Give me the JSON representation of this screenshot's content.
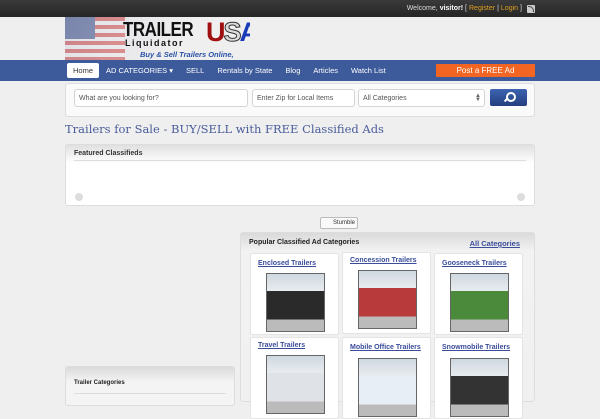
{
  "topbar": {
    "welcome": "Welcome,",
    "user": "visitor!",
    "open": "[",
    "register": "Register",
    "sep": "|",
    "login": "Login",
    "close": "]"
  },
  "logo": {
    "line1": "TRAILER",
    "line2": "Liquidator",
    "usa_u": "U",
    "usa_s": "S",
    "usa_a": "A",
    "tagline": "Buy & Sell Trailers Online, FREE!"
  },
  "nav": {
    "items": [
      "Home",
      "AD CATEGORIES ▾",
      "SELL",
      "Rentals by State",
      "Blog",
      "Articles",
      "Watch List"
    ],
    "post": "Post a FREE Ad"
  },
  "search": {
    "keyword_placeholder": "What are you looking for?",
    "zip_placeholder": "Enter Zip for Local Items",
    "category": "All Categories"
  },
  "page_title": "Trailers for Sale - BUY/SELL with FREE Classified Ads",
  "featured": {
    "title": "Featured Classifieds"
  },
  "stumble": "Stumble",
  "popular": {
    "title": "Popular Classified Ad Categories",
    "all": "All Categories",
    "categories": [
      {
        "name": "Enclosed Trailers",
        "color": "#2a2a2a"
      },
      {
        "name": "Concession Trailers",
        "color": "#b83a3a"
      },
      {
        "name": "Gooseneck Trailers",
        "color": "#4a8a3a"
      },
      {
        "name": "Travel Trailers",
        "color": "#dfe2e6"
      },
      {
        "name": "Mobile Office Trailers",
        "color": "#e8eef6"
      },
      {
        "name": "Snowmobile Trailers",
        "color": "#333"
      }
    ]
  },
  "sidebar": {
    "title": "Trailer Categories"
  }
}
